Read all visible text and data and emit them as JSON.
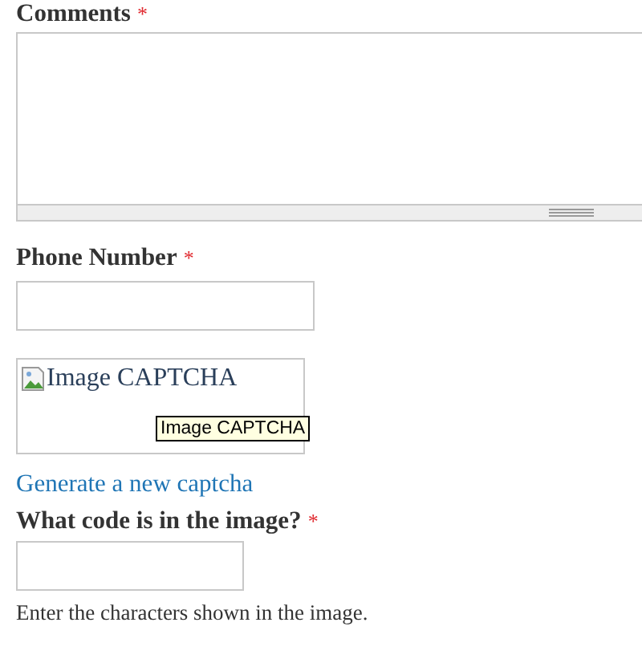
{
  "comments": {
    "label": "Comments",
    "required_mark": "*"
  },
  "phone": {
    "label": "Phone Number",
    "required_mark": "*"
  },
  "captcha": {
    "alt_text": "Image CAPTCHA",
    "tooltip": "Image CAPTCHA",
    "link": "Generate a new captcha"
  },
  "code": {
    "label": "What code is in the image?",
    "required_mark": "*",
    "description": "Enter the characters shown in the image."
  }
}
